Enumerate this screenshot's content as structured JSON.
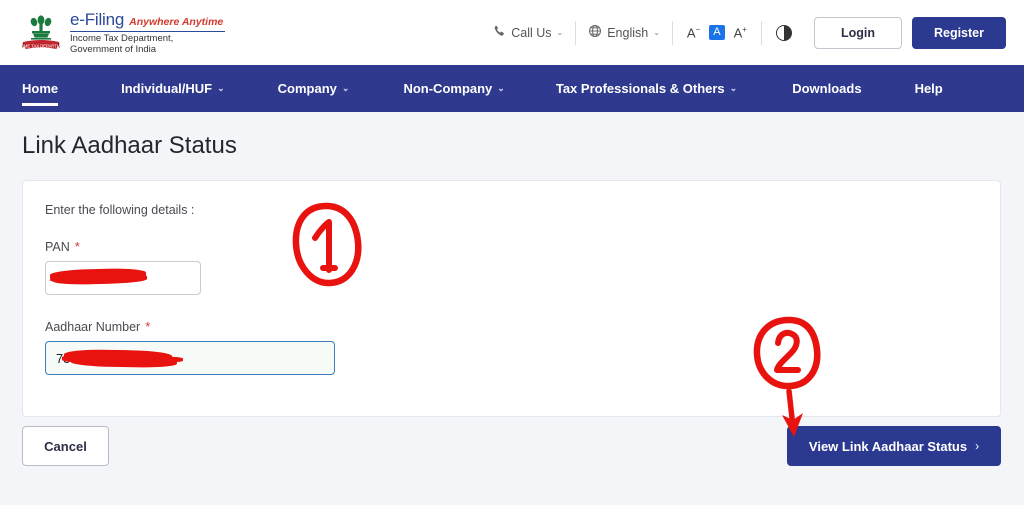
{
  "header": {
    "brand": {
      "emblem_icon": "india-emblem-icon",
      "title": "e-Filing",
      "tagline": "Anywhere Anytime",
      "subtitle": "Income Tax Department, Government of India"
    },
    "call_us": {
      "label": "Call Us",
      "icon": "phone-icon",
      "caret": "⌄"
    },
    "language": {
      "label": "English",
      "icon": "globe-icon",
      "caret": "⌄"
    },
    "font_controls": {
      "decrease": "A",
      "decrease_sup": "−",
      "normal": "A",
      "increase": "A",
      "increase_sup": "+",
      "active_color": "#1a73e8"
    },
    "contrast_icon": "contrast-toggle-icon",
    "login_label": "Login",
    "register_label": "Register"
  },
  "nav": {
    "bg_color": "#2f3a8f",
    "items": [
      {
        "label": "Home",
        "caret": "",
        "active": true
      },
      {
        "label": "Individual/HUF",
        "caret": "⌄",
        "active": false
      },
      {
        "label": "Company",
        "caret": "⌄",
        "active": false
      },
      {
        "label": "Non-Company",
        "caret": "⌄",
        "active": false
      },
      {
        "label": "Tax Professionals & Others",
        "caret": "⌄",
        "active": false
      },
      {
        "label": "Downloads",
        "caret": "",
        "active": false
      },
      {
        "label": "Help",
        "caret": "",
        "active": false
      }
    ]
  },
  "main": {
    "page_title": "Link Aadhaar Status",
    "intro": "Enter the following details :",
    "fields": [
      {
        "label": "PAN",
        "required_marker": "*",
        "value": "",
        "placeholder": "",
        "redacted": true,
        "focused": false
      },
      {
        "label": "Aadhaar Number",
        "required_marker": "*",
        "value": "75",
        "placeholder": "",
        "redacted": true,
        "focused": true
      }
    ],
    "cancel_label": "Cancel",
    "submit_label": "View Link Aadhaar Status",
    "submit_chevron": "›"
  },
  "annotations": {
    "color": "#e8130f",
    "markers": [
      {
        "name": "circled-one",
        "text": "1"
      },
      {
        "name": "circled-two-with-arrow",
        "text": "2"
      }
    ]
  },
  "colors": {
    "primary_blue": "#2b3990",
    "nav_blue": "#2f3a8f",
    "page_bg": "#f4f5f9",
    "annotation_red": "#e8130f",
    "required_red": "#d0343a"
  }
}
